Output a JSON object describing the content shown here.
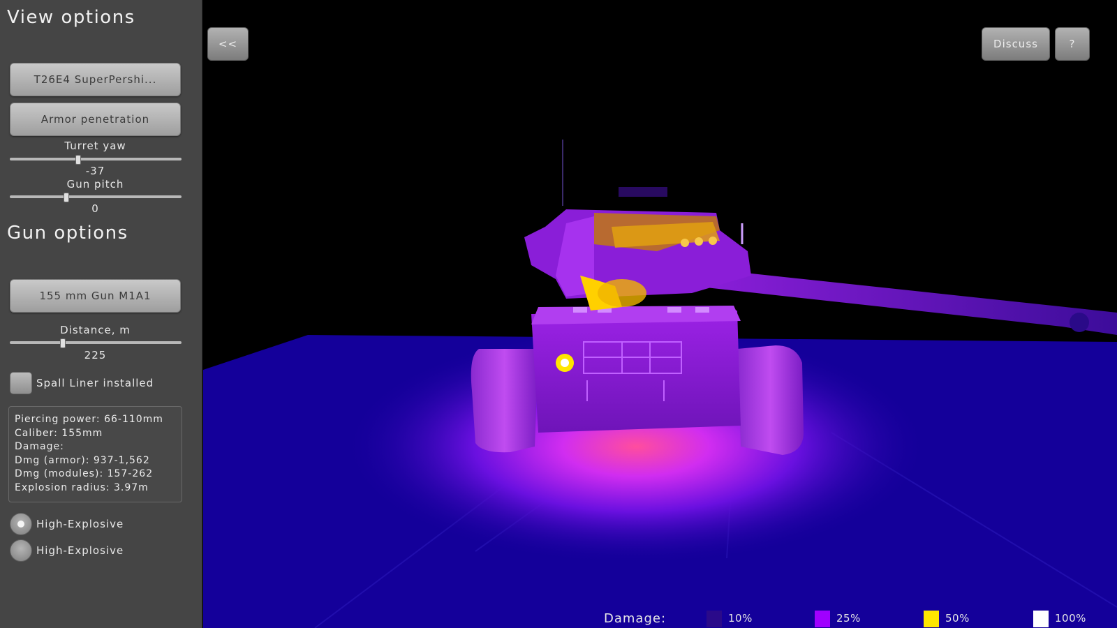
{
  "sidebar": {
    "view_options_title": "View options",
    "vehicle_button": "T26E4 SuperPershi...",
    "mode_button": "Armor penetration",
    "turret_yaw": {
      "label": "Turret yaw",
      "value": "-37",
      "position": 0.4
    },
    "gun_pitch": {
      "label": "Gun pitch",
      "value": "0",
      "position": 0.33
    },
    "gun_options_title": "Gun options",
    "gun_button": "155 mm Gun M1A1",
    "distance": {
      "label": "Distance, m",
      "value": "225",
      "position": 0.31
    },
    "spall_liner_label": "Spall Liner installed",
    "spall_liner_checked": false,
    "info": {
      "line1": "Piercing power: 66-110mm",
      "line2": "Caliber: 155mm",
      "line3": "Damage:",
      "line4": "Dmg (armor): 937-1,562",
      "line5": "Dmg (modules): 157-262",
      "line6": "Explosion radius: 3.97m"
    },
    "ammo": [
      {
        "label": "High-Explosive",
        "selected": true
      },
      {
        "label": "High-Explosive",
        "selected": false
      }
    ]
  },
  "topbar": {
    "back_label": "<<",
    "discuss_label": "Discuss",
    "help_label": "?"
  },
  "legend": {
    "title": "Damage:",
    "items": [
      {
        "value": "10%",
        "color": "#2a0a8a"
      },
      {
        "value": "25%",
        "color": "#a000ff"
      },
      {
        "value": "50%",
        "color": "#ffe600"
      },
      {
        "value": "100%",
        "color": "#ffffff"
      }
    ]
  },
  "colors": {
    "background": "#000000",
    "ground": "#14009a",
    "tank_body": "#8a1ad8",
    "hot_spot": "#ffd400"
  }
}
